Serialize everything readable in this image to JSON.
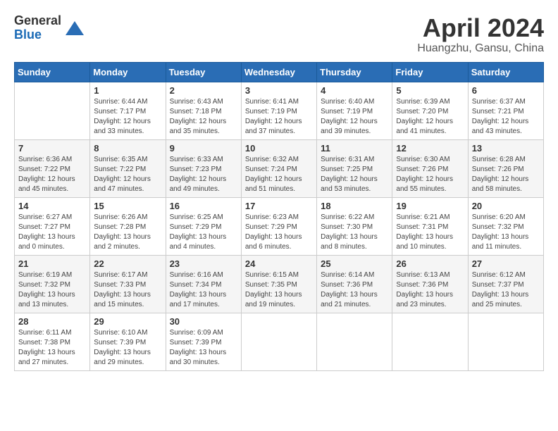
{
  "header": {
    "logo_general": "General",
    "logo_blue": "Blue",
    "month_title": "April 2024",
    "location": "Huangzhu, Gansu, China"
  },
  "calendar": {
    "days_of_week": [
      "Sunday",
      "Monday",
      "Tuesday",
      "Wednesday",
      "Thursday",
      "Friday",
      "Saturday"
    ],
    "weeks": [
      [
        {
          "day": "",
          "info": ""
        },
        {
          "day": "1",
          "info": "Sunrise: 6:44 AM\nSunset: 7:17 PM\nDaylight: 12 hours\nand 33 minutes."
        },
        {
          "day": "2",
          "info": "Sunrise: 6:43 AM\nSunset: 7:18 PM\nDaylight: 12 hours\nand 35 minutes."
        },
        {
          "day": "3",
          "info": "Sunrise: 6:41 AM\nSunset: 7:19 PM\nDaylight: 12 hours\nand 37 minutes."
        },
        {
          "day": "4",
          "info": "Sunrise: 6:40 AM\nSunset: 7:19 PM\nDaylight: 12 hours\nand 39 minutes."
        },
        {
          "day": "5",
          "info": "Sunrise: 6:39 AM\nSunset: 7:20 PM\nDaylight: 12 hours\nand 41 minutes."
        },
        {
          "day": "6",
          "info": "Sunrise: 6:37 AM\nSunset: 7:21 PM\nDaylight: 12 hours\nand 43 minutes."
        }
      ],
      [
        {
          "day": "7",
          "info": "Sunrise: 6:36 AM\nSunset: 7:22 PM\nDaylight: 12 hours\nand 45 minutes."
        },
        {
          "day": "8",
          "info": "Sunrise: 6:35 AM\nSunset: 7:22 PM\nDaylight: 12 hours\nand 47 minutes."
        },
        {
          "day": "9",
          "info": "Sunrise: 6:33 AM\nSunset: 7:23 PM\nDaylight: 12 hours\nand 49 minutes."
        },
        {
          "day": "10",
          "info": "Sunrise: 6:32 AM\nSunset: 7:24 PM\nDaylight: 12 hours\nand 51 minutes."
        },
        {
          "day": "11",
          "info": "Sunrise: 6:31 AM\nSunset: 7:25 PM\nDaylight: 12 hours\nand 53 minutes."
        },
        {
          "day": "12",
          "info": "Sunrise: 6:30 AM\nSunset: 7:26 PM\nDaylight: 12 hours\nand 55 minutes."
        },
        {
          "day": "13",
          "info": "Sunrise: 6:28 AM\nSunset: 7:26 PM\nDaylight: 12 hours\nand 58 minutes."
        }
      ],
      [
        {
          "day": "14",
          "info": "Sunrise: 6:27 AM\nSunset: 7:27 PM\nDaylight: 13 hours\nand 0 minutes."
        },
        {
          "day": "15",
          "info": "Sunrise: 6:26 AM\nSunset: 7:28 PM\nDaylight: 13 hours\nand 2 minutes."
        },
        {
          "day": "16",
          "info": "Sunrise: 6:25 AM\nSunset: 7:29 PM\nDaylight: 13 hours\nand 4 minutes."
        },
        {
          "day": "17",
          "info": "Sunrise: 6:23 AM\nSunset: 7:29 PM\nDaylight: 13 hours\nand 6 minutes."
        },
        {
          "day": "18",
          "info": "Sunrise: 6:22 AM\nSunset: 7:30 PM\nDaylight: 13 hours\nand 8 minutes."
        },
        {
          "day": "19",
          "info": "Sunrise: 6:21 AM\nSunset: 7:31 PM\nDaylight: 13 hours\nand 10 minutes."
        },
        {
          "day": "20",
          "info": "Sunrise: 6:20 AM\nSunset: 7:32 PM\nDaylight: 13 hours\nand 11 minutes."
        }
      ],
      [
        {
          "day": "21",
          "info": "Sunrise: 6:19 AM\nSunset: 7:32 PM\nDaylight: 13 hours\nand 13 minutes."
        },
        {
          "day": "22",
          "info": "Sunrise: 6:17 AM\nSunset: 7:33 PM\nDaylight: 13 hours\nand 15 minutes."
        },
        {
          "day": "23",
          "info": "Sunrise: 6:16 AM\nSunset: 7:34 PM\nDaylight: 13 hours\nand 17 minutes."
        },
        {
          "day": "24",
          "info": "Sunrise: 6:15 AM\nSunset: 7:35 PM\nDaylight: 13 hours\nand 19 minutes."
        },
        {
          "day": "25",
          "info": "Sunrise: 6:14 AM\nSunset: 7:36 PM\nDaylight: 13 hours\nand 21 minutes."
        },
        {
          "day": "26",
          "info": "Sunrise: 6:13 AM\nSunset: 7:36 PM\nDaylight: 13 hours\nand 23 minutes."
        },
        {
          "day": "27",
          "info": "Sunrise: 6:12 AM\nSunset: 7:37 PM\nDaylight: 13 hours\nand 25 minutes."
        }
      ],
      [
        {
          "day": "28",
          "info": "Sunrise: 6:11 AM\nSunset: 7:38 PM\nDaylight: 13 hours\nand 27 minutes."
        },
        {
          "day": "29",
          "info": "Sunrise: 6:10 AM\nSunset: 7:39 PM\nDaylight: 13 hours\nand 29 minutes."
        },
        {
          "day": "30",
          "info": "Sunrise: 6:09 AM\nSunset: 7:39 PM\nDaylight: 13 hours\nand 30 minutes."
        },
        {
          "day": "",
          "info": ""
        },
        {
          "day": "",
          "info": ""
        },
        {
          "day": "",
          "info": ""
        },
        {
          "day": "",
          "info": ""
        }
      ]
    ]
  }
}
